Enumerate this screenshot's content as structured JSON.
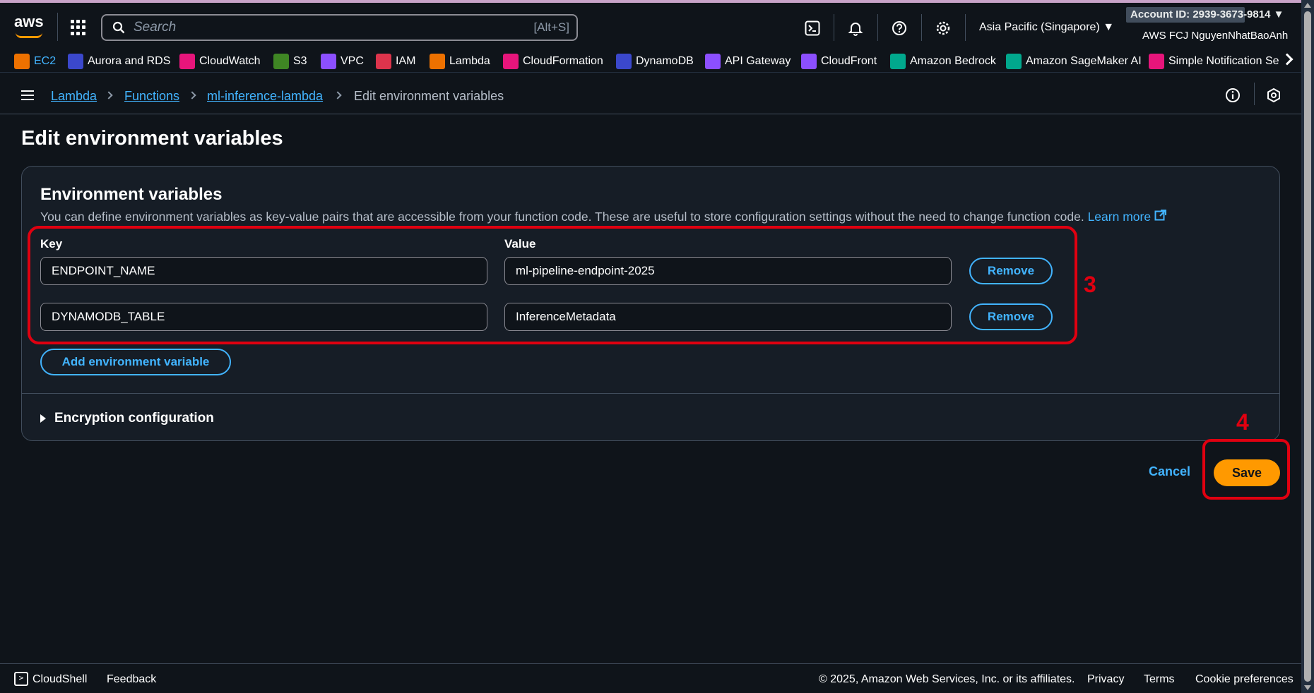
{
  "header": {
    "logo_text": "aws",
    "search_placeholder": "Search",
    "search_shortcut": "[Alt+S]",
    "region": "Asia Pacific (Singapore) ▼",
    "account": "Account ID: 2939-3673-9814 ▼",
    "user": "AWS FCJ NguyenNhatBaoAnh",
    "icons": [
      "cloudshell-icon",
      "bell-icon",
      "help-icon",
      "gear-icon"
    ]
  },
  "favorites": [
    {
      "label": "EC2",
      "color": "#ed7100",
      "highlight": true
    },
    {
      "label": "Aurora and RDS",
      "color": "#3b48cc"
    },
    {
      "label": "CloudWatch",
      "color": "#e7157b"
    },
    {
      "label": "S3",
      "color": "#3f8624"
    },
    {
      "label": "VPC",
      "color": "#8c4fff"
    },
    {
      "label": "IAM",
      "color": "#dd344c"
    },
    {
      "label": "Lambda",
      "color": "#ed7100"
    },
    {
      "label": "CloudFormation",
      "color": "#e7157b"
    },
    {
      "label": "DynamoDB",
      "color": "#3b48cc"
    },
    {
      "label": "API Gateway",
      "color": "#8c4fff"
    },
    {
      "label": "CloudFront",
      "color": "#8c4fff"
    },
    {
      "label": "Amazon Bedrock",
      "color": "#01a88d"
    },
    {
      "label": "Amazon SageMaker AI",
      "color": "#01a88d"
    },
    {
      "label": "Simple Notification Se",
      "color": "#e7157b"
    }
  ],
  "breadcrumb": {
    "items": [
      "Lambda",
      "Functions",
      "ml-inference-lambda"
    ],
    "current": "Edit environment variables"
  },
  "page": {
    "title": "Edit environment variables"
  },
  "env_panel": {
    "title": "Environment variables",
    "description": "You can define environment variables as key-value pairs that are accessible from your function code. These are useful to store configuration settings without the need to change function code.",
    "learn_more": "Learn more",
    "key_label": "Key",
    "value_label": "Value",
    "rows": [
      {
        "key": "ENDPOINT_NAME",
        "value": "ml-pipeline-endpoint-2025",
        "remove": "Remove"
      },
      {
        "key": "DYNAMODB_TABLE",
        "value": "InferenceMetadata",
        "remove": "Remove"
      }
    ],
    "add_button": "Add environment variable",
    "encryption": "Encryption configuration"
  },
  "actions": {
    "cancel": "Cancel",
    "save": "Save"
  },
  "annotations": {
    "step3": "3",
    "step4": "4",
    "color": "#e00010"
  },
  "footer": {
    "cloudshell": "CloudShell",
    "feedback": "Feedback",
    "copyright": "© 2025, Amazon Web Services, Inc. or its affiliates.",
    "privacy": "Privacy",
    "terms": "Terms",
    "cookie": "Cookie preferences"
  }
}
